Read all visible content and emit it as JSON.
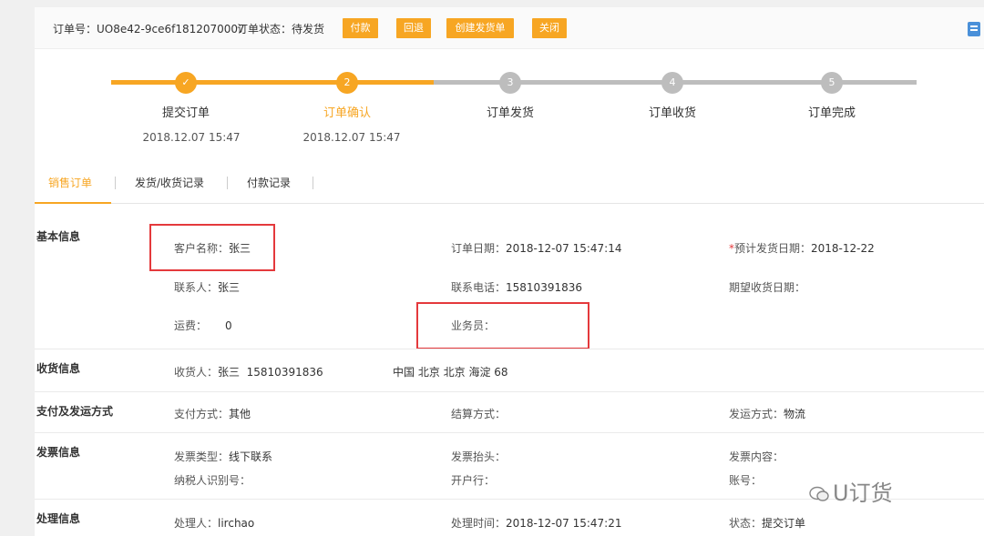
{
  "header": {
    "order_no_label": "订单号：",
    "order_no": "UO8e42-9ce6f1812070007",
    "status_label": "订单状态：",
    "status": "待发货",
    "buttons": [
      "付款",
      "回退",
      "创建发货单",
      "关闭"
    ]
  },
  "steps": [
    {
      "index": "✓",
      "label": "提交订单",
      "time": "2018.12.07 15:47",
      "state": "done"
    },
    {
      "index": "2",
      "label": "订单确认",
      "time": "2018.12.07 15:47",
      "state": "current"
    },
    {
      "index": "3",
      "label": "订单发货",
      "time": "",
      "state": "todo"
    },
    {
      "index": "4",
      "label": "订单收货",
      "time": "",
      "state": "todo"
    },
    {
      "index": "5",
      "label": "订单完成",
      "time": "",
      "state": "todo"
    }
  ],
  "colors": {
    "accent": "#f7a623",
    "inactive": "#bdbdbd",
    "highlight": "#e4393c"
  },
  "tabs": [
    "销售订单",
    "发货/收货记录",
    "付款记录"
  ],
  "basic": {
    "title": "基本信息",
    "customer": {
      "k": "客户名称：",
      "v": "张三"
    },
    "order_date": {
      "k": "订单日期：",
      "v": "2018-12-07 15:47:14"
    },
    "ship_date": {
      "req": "*",
      "k": "预计发货日期：",
      "v": "2018-12-22"
    },
    "contact": {
      "k": "联系人：",
      "v": "张三"
    },
    "phone": {
      "k": "联系电话：",
      "v": "15810391836"
    },
    "expect_recv": {
      "k": "期望收货日期：",
      "v": ""
    },
    "freight": {
      "k": "运费：",
      "v": "0"
    },
    "salesman": {
      "k": "业务员：",
      "v": ""
    }
  },
  "receive": {
    "title": "收货信息",
    "receiver": {
      "k": "收货人：",
      "v": "张三  15810391836"
    },
    "address": "中国 北京 北京 海淀 68"
  },
  "payment": {
    "title": "支付及发运方式",
    "pay_method": {
      "k": "支付方式：",
      "v": "其他"
    },
    "settle": {
      "k": "结算方式：",
      "v": ""
    },
    "ship_method": {
      "k": "发运方式：",
      "v": "物流"
    }
  },
  "invoice": {
    "title": "发票信息",
    "type": {
      "k": "发票类型：",
      "v": "线下联系"
    },
    "head": {
      "k": "发票抬头：",
      "v": ""
    },
    "content": {
      "k": "发票内容：",
      "v": ""
    },
    "tax_id": {
      "k": "纳税人识别号：",
      "v": ""
    },
    "bank": {
      "k": "开户行：",
      "v": ""
    },
    "account": {
      "k": "账号：",
      "v": ""
    }
  },
  "process": {
    "title": "处理信息",
    "handler": {
      "k": "处理人：",
      "v": "lirchao"
    },
    "time": {
      "k": "处理时间：",
      "v": "2018-12-07 15:47:21"
    },
    "state": {
      "k": "状态：",
      "v": "提交订单"
    }
  },
  "watermark": "U订货"
}
